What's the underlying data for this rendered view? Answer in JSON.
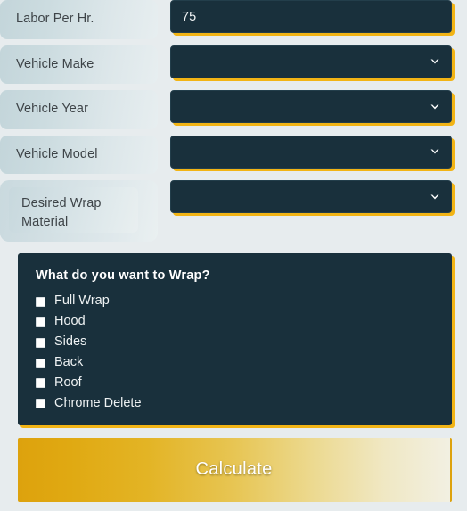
{
  "theme": {
    "page_background": "#e7ecee",
    "control_background": "#19303c",
    "accent_gold": "#f2b415",
    "button_gold": "#dda20d",
    "label_text": "#3e4448"
  },
  "form": {
    "fields": [
      {
        "label": "Labor Per Hr.",
        "type": "text",
        "value": "75",
        "placeholder": "",
        "name": "labor-per-hr"
      },
      {
        "label": "Vehicle Make",
        "type": "select",
        "value": "",
        "name": "vehicle-make"
      },
      {
        "label": "Vehicle Year",
        "type": "select",
        "value": "",
        "name": "vehicle-year"
      },
      {
        "label": "Vehicle Model",
        "type": "select",
        "value": "",
        "name": "vehicle-model"
      },
      {
        "label": "Desired Wrap Material",
        "type": "select",
        "value": "",
        "name": "desired-wrap-material"
      }
    ]
  },
  "wrap_panel": {
    "title": "What do you want to Wrap?",
    "options": [
      {
        "label": "Full Wrap",
        "checked": false
      },
      {
        "label": "Hood",
        "checked": false
      },
      {
        "label": "Sides",
        "checked": false
      },
      {
        "label": "Back",
        "checked": false
      },
      {
        "label": "Roof",
        "checked": false
      },
      {
        "label": "Chrome Delete",
        "checked": false
      }
    ]
  },
  "actions": {
    "calculate_label": "Calculate"
  },
  "icons": {
    "chevron_down": "chevron-down-icon"
  }
}
